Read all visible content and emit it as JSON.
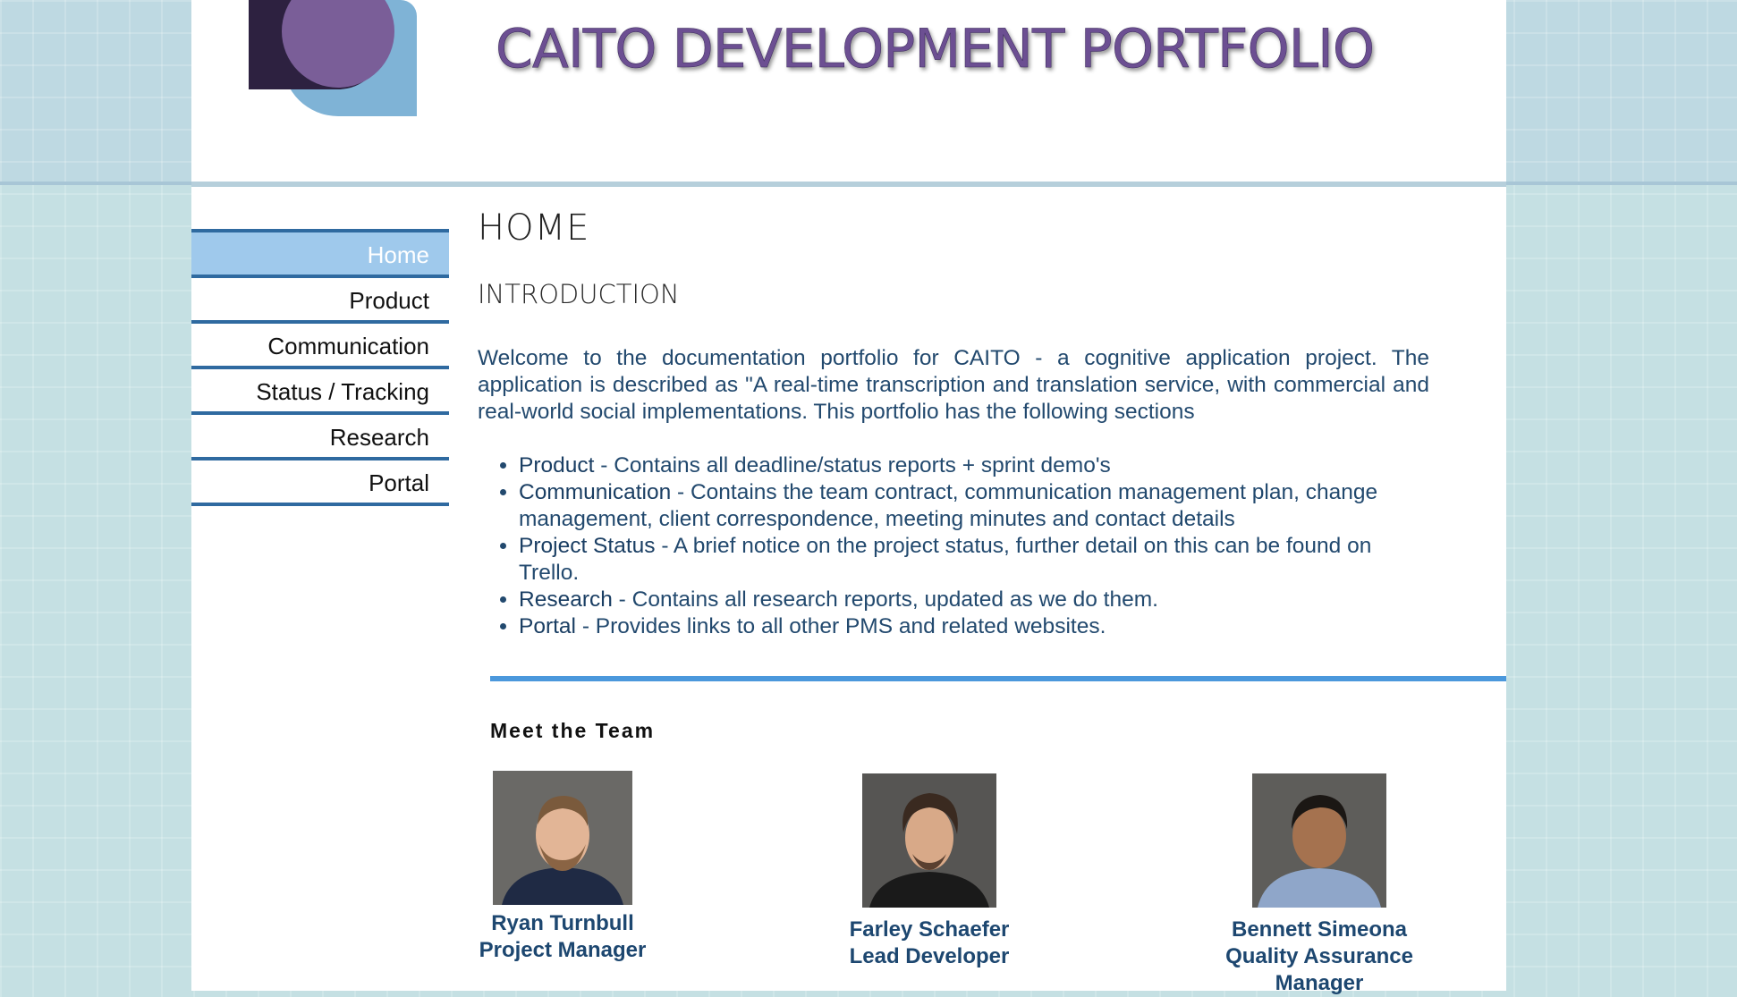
{
  "site": {
    "title": "CAITO DEVELOPMENT PORTFOLIO"
  },
  "colors": {
    "page_background": "#c5e0e3",
    "title": "#6c4f92",
    "nav_active": "#9fc9ec",
    "nav_border": "#2f6aa0",
    "body_text": "#22496e",
    "accent_rule": "#4b98dc",
    "logo_dark": "#2d2140",
    "logo_purple": "#7a5e98",
    "logo_blue": "#7fb3d6"
  },
  "nav": {
    "items": [
      {
        "label": "Home",
        "active": true
      },
      {
        "label": "Product"
      },
      {
        "label": "Communication"
      },
      {
        "label": "Status / Tracking"
      },
      {
        "label": "Research"
      },
      {
        "label": "Portal"
      }
    ]
  },
  "main": {
    "heading": "HOME",
    "section_heading": "INTRODUCTION",
    "intro": "Welcome to the documentation portfolio for CAITO - a cognitive application project. The application is described as \"A real-time transcription and translation service, with commercial and real-world social implementations. This portfolio has the following sections",
    "sections": [
      {
        "term": "Product",
        "text": " - Contains all deadline/status reports + sprint demo's"
      },
      {
        "term": "Communication",
        "text": " - Contains the team contract, communication management plan, change management, client correspondence, meeting minutes and contact details"
      },
      {
        "term": "Project Status",
        "text": " - A brief notice on the project status, further detail on this can be found on Trello."
      },
      {
        "term": "Research",
        "text": " - Contains all research reports, updated as we do them."
      },
      {
        "term": "Portal",
        "text": " - Provides links to all other PMS and related websites."
      }
    ]
  },
  "team": {
    "heading": "Meet the Team",
    "members": [
      {
        "name": "Ryan Turnbull",
        "role_lines": [
          "Project Manager"
        ],
        "photo_icon": "person-photo"
      },
      {
        "name": "Farley Schaefer",
        "role_lines": [
          "Lead Developer"
        ],
        "photo_icon": "person-photo"
      },
      {
        "name": "Bennett Simeona",
        "role_lines": [
          "Quality Assurance",
          "Manager"
        ],
        "photo_icon": "person-photo"
      }
    ]
  }
}
